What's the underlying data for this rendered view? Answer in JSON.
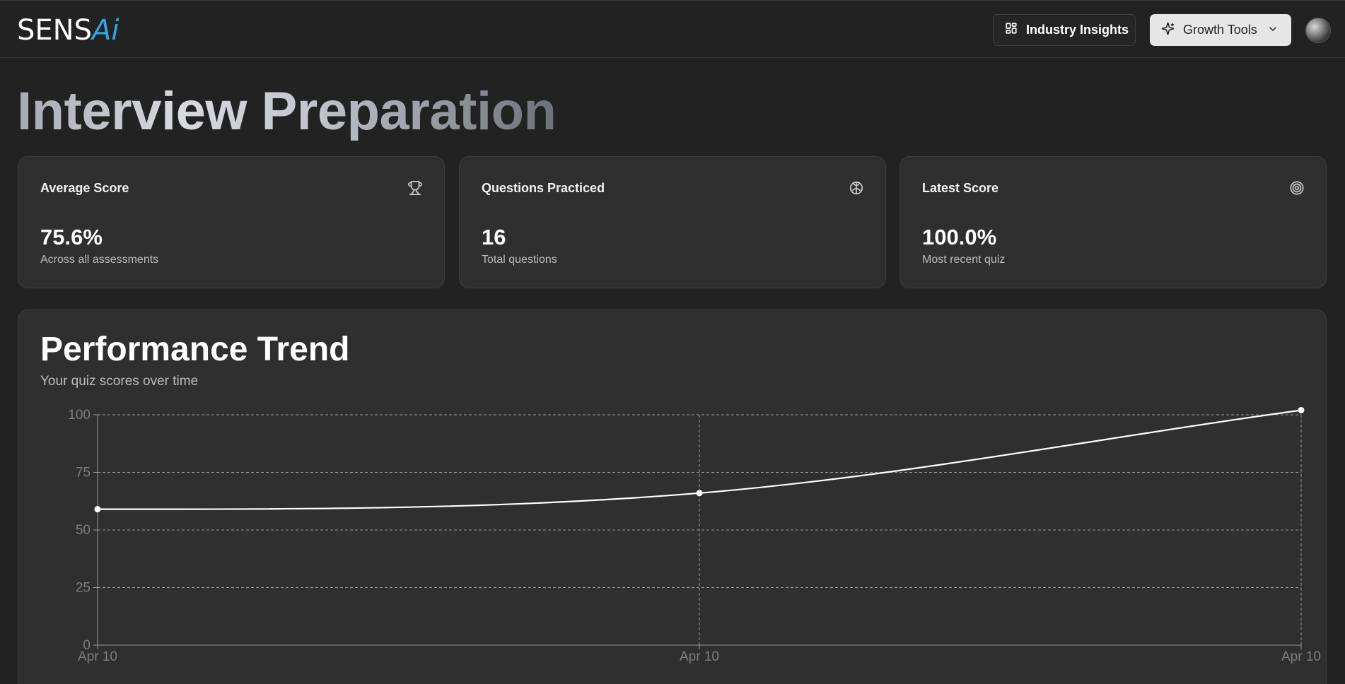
{
  "header": {
    "logo_main": "SENS",
    "logo_accent": "Ai",
    "insights_label": "Industry Insights",
    "growth_label": "Growth Tools",
    "insights_icon": "layout-dashboard-icon",
    "growth_icon": "sparkles-icon",
    "growth_chevron": "chevron-down-icon"
  },
  "page": {
    "title": "Interview Preparation"
  },
  "stats": [
    {
      "title": "Average Score",
      "value": "75.6%",
      "subtitle": "Across all assessments",
      "icon": "trophy-icon"
    },
    {
      "title": "Questions Practiced",
      "value": "16",
      "subtitle": "Total questions",
      "icon": "brain-icon"
    },
    {
      "title": "Latest Score",
      "value": "100.0%",
      "subtitle": "Most recent quiz",
      "icon": "target-icon"
    }
  ],
  "performance": {
    "title": "Performance Trend",
    "subtitle": "Your quiz scores over time"
  },
  "chart_data": {
    "type": "line",
    "title": "",
    "xlabel": "",
    "ylabel": "",
    "categories": [
      "Apr 10",
      "Apr 10",
      "Apr 10"
    ],
    "values": [
      59,
      66,
      102
    ],
    "ylim": [
      0,
      100
    ],
    "yticks": [
      0,
      25,
      50,
      75,
      100
    ],
    "grid": "dashed",
    "line_color": "#ffffff"
  }
}
